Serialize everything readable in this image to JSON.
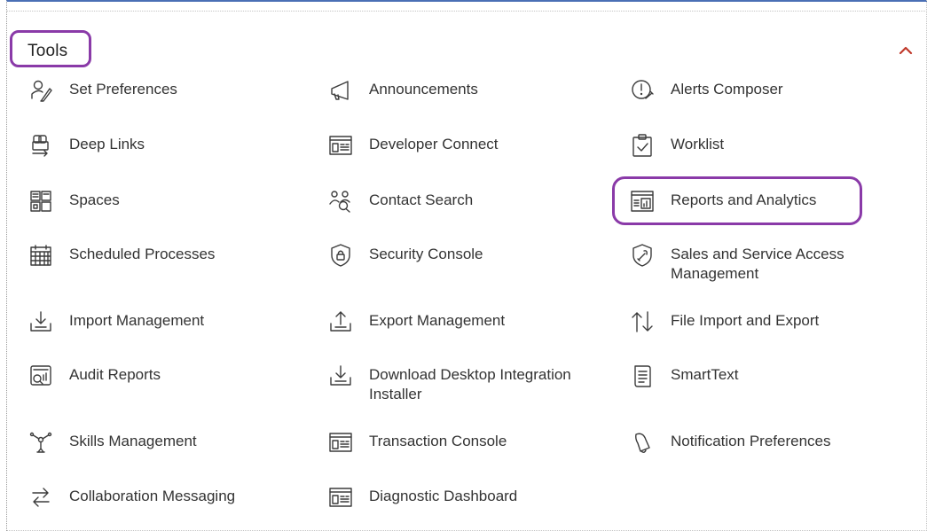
{
  "section": {
    "title": "Tools",
    "collapse_icon": "chevron-up-icon",
    "accent_color": "#c0392b",
    "highlight_color": "#8a3aa8"
  },
  "tools": {
    "col1": [
      {
        "label": "Set Preferences",
        "icon": "user-pen-icon"
      },
      {
        "label": "Deep Links",
        "icon": "deep-links-icon"
      },
      {
        "label": "Spaces",
        "icon": "spaces-grid-icon"
      },
      {
        "label": "Scheduled Processes",
        "icon": "calendar-icon"
      },
      {
        "label": "Import Management",
        "icon": "import-tray-icon"
      },
      {
        "label": "Audit Reports",
        "icon": "audit-report-icon"
      },
      {
        "label": "Skills Management",
        "icon": "skills-network-icon"
      },
      {
        "label": "Collaboration Messaging",
        "icon": "exchange-arrows-icon"
      }
    ],
    "col2": [
      {
        "label": "Announcements",
        "icon": "megaphone-icon"
      },
      {
        "label": "Developer Connect",
        "icon": "console-window-icon"
      },
      {
        "label": "Contact Search",
        "icon": "people-search-icon"
      },
      {
        "label": "Security Console",
        "icon": "shield-lock-icon"
      },
      {
        "label": "Export Management",
        "icon": "export-tray-icon"
      },
      {
        "label": "Download Desktop Integration Installer",
        "icon": "download-tray-icon"
      },
      {
        "label": "Transaction Console",
        "icon": "console-window-icon"
      },
      {
        "label": "Diagnostic Dashboard",
        "icon": "console-window-icon"
      }
    ],
    "col3": [
      {
        "label": "Alerts Composer",
        "icon": "alert-wrench-icon"
      },
      {
        "label": "Worklist",
        "icon": "clipboard-check-icon"
      },
      {
        "label": "Reports and Analytics",
        "icon": "report-chart-icon",
        "highlighted": true
      },
      {
        "label": "Sales and Service Access Management",
        "icon": "shield-wrench-icon"
      },
      {
        "label": "File Import and Export",
        "icon": "up-down-arrows-icon"
      },
      {
        "label": "SmartText",
        "icon": "document-lines-icon"
      },
      {
        "label": "Notification Preferences",
        "icon": "bell-icon"
      }
    ]
  }
}
